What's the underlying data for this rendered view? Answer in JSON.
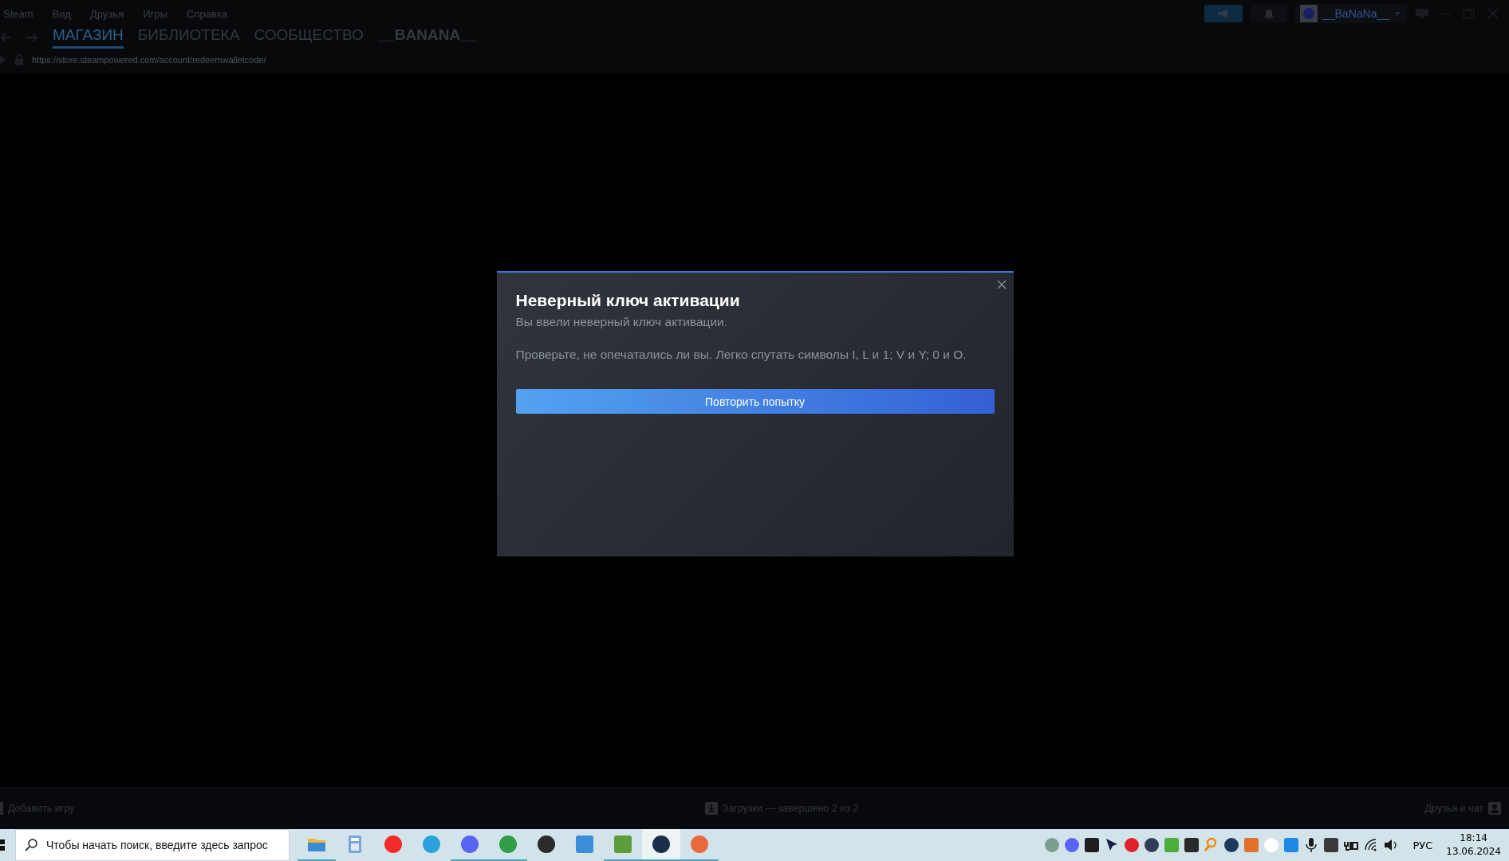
{
  "menu": [
    "Steam",
    "Вид",
    "Друзья",
    "Игры",
    "Справка"
  ],
  "tabs": [
    {
      "label": "МАГАЗИН",
      "selected": true
    },
    {
      "label": "БИБЛИОТЕКА",
      "selected": false
    },
    {
      "label": "СООБЩЕСТВО",
      "selected": false
    },
    {
      "label": "__BANANA__",
      "selected": false
    }
  ],
  "url": "https://store.steampowered.com/account/redeemwalletcode/",
  "user": {
    "name": "__BaNaNa__"
  },
  "dialog": {
    "title": "Неверный ключ активации",
    "message": "Вы ввели неверный ключ активации.",
    "hint": "Проверьте, не опечатались ли вы. Легко спутать символы I, L и 1; V и Y; 0 и O.",
    "button": "Повторить попытку"
  },
  "bottom_bar": {
    "add_game": "Добавить игру",
    "downloads": "Загрузки — завершено 2 из 2",
    "friends": "Друзья и чат"
  },
  "taskbar": {
    "search": {
      "placeholder": "Чтобы начать поиск, введите здесь запрос"
    },
    "apps": [
      {
        "kind": "folder",
        "color": "#f2b632",
        "running": true,
        "active": false
      },
      {
        "kind": "calculator",
        "color": "#7aa6d6",
        "running": false,
        "active": false
      },
      {
        "kind": "circle",
        "color": "#f22a2a",
        "running": false,
        "active": false
      },
      {
        "kind": "circle",
        "color": "#2aa3dd",
        "running": false,
        "active": false
      },
      {
        "kind": "circle",
        "color": "#5865f2",
        "running": true,
        "active": false
      },
      {
        "kind": "circle",
        "color": "#2e9e48",
        "running": true,
        "active": false
      },
      {
        "kind": "circle",
        "color": "#2b2b2b",
        "running": false,
        "active": false
      },
      {
        "kind": "tile",
        "color": "#3c8dd8",
        "running": false,
        "active": false
      },
      {
        "kind": "tile",
        "color": "#5c9c3a",
        "running": true,
        "active": false
      },
      {
        "kind": "circle",
        "color": "#1b2f4a",
        "running": true,
        "active": true
      },
      {
        "kind": "circle",
        "color": "#e86a3c",
        "running": true,
        "active": false
      }
    ],
    "tray": [
      {
        "kind": "circle",
        "color": "#7d9e8e"
      },
      {
        "kind": "circle",
        "color": "#5865f2"
      },
      {
        "kind": "tile",
        "color": "#1e1e1e"
      },
      {
        "kind": "cursor",
        "color": "#1a1a4a"
      },
      {
        "kind": "circle",
        "color": "#e0202a"
      },
      {
        "kind": "circle",
        "color": "#2e3e5a"
      },
      {
        "kind": "tile",
        "color": "#4cae3c"
      },
      {
        "kind": "tile",
        "color": "#2a2a2a"
      },
      {
        "kind": "ring",
        "color": "#f08a10"
      },
      {
        "kind": "circle",
        "color": "#1b3a5c"
      },
      {
        "kind": "tile",
        "color": "#e0702a"
      },
      {
        "kind": "circle",
        "color": "#ffffff"
      },
      {
        "kind": "tile",
        "color": "#1e88e5"
      },
      {
        "kind": "mic",
        "color": "#1a1a1a"
      },
      {
        "kind": "tile",
        "color": "#3a3a3a"
      },
      {
        "kind": "plug",
        "color": "#1a1a1a"
      },
      {
        "kind": "wifi",
        "color": "#1a1a1a"
      },
      {
        "kind": "speaker",
        "color": "#1a1a1a"
      }
    ],
    "language": "РУС",
    "time": "18:14",
    "date": "13.06.2024"
  }
}
